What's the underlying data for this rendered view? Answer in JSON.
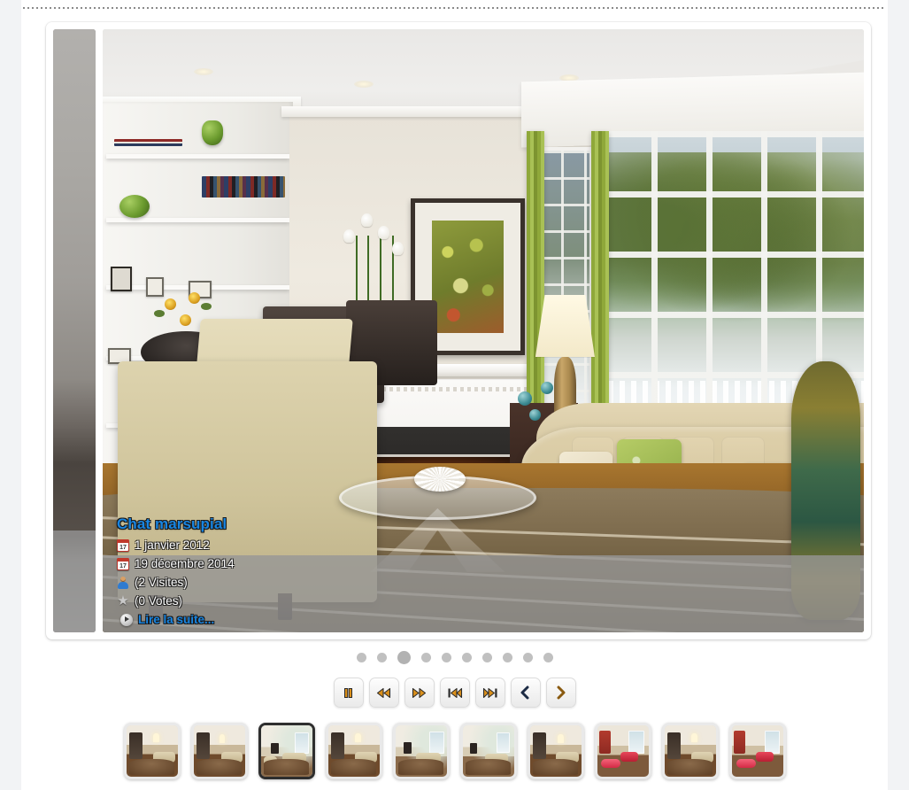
{
  "slideshow": {
    "caption": {
      "title": "Chat marsupial",
      "date_created": "1 janvier 2012",
      "date_modified": "19 décembre 2014",
      "visits": "(2 Visites)",
      "votes": "(0 Votes)",
      "read_more": "Lire la suite...",
      "icons": {
        "created": "calendar-icon",
        "modified": "calendar-icon",
        "visits": "user-icon",
        "votes": "star-icon",
        "read_more": "play-circle-icon"
      },
      "title_color": "#1884e0",
      "scrim_color": "#969696"
    },
    "pagination": {
      "count": 10,
      "active_index": 2
    },
    "controls": [
      {
        "name": "pause-button",
        "icon": "pause-icon",
        "label": "Pause"
      },
      {
        "name": "rewind-button",
        "icon": "rewind-icon",
        "label": "Rewind"
      },
      {
        "name": "fast-forward-button",
        "icon": "fast-forward-icon",
        "label": "Fast forward"
      },
      {
        "name": "first-button",
        "icon": "skip-start-icon",
        "label": "First"
      },
      {
        "name": "last-button",
        "icon": "skip-end-icon",
        "label": "Last"
      },
      {
        "name": "previous-button",
        "icon": "chevron-left-icon",
        "label": "Previous"
      },
      {
        "name": "next-button",
        "icon": "chevron-right-icon",
        "label": "Next"
      }
    ],
    "thumbnails": [
      {
        "index": 1,
        "scene": "modern-living-room-dark-tv",
        "selected": false
      },
      {
        "index": 2,
        "scene": "modern-living-room-dark-tv",
        "selected": false
      },
      {
        "index": 3,
        "scene": "fireplace-living-room-green",
        "selected": true
      },
      {
        "index": 4,
        "scene": "modern-living-room-dark-tv",
        "selected": false
      },
      {
        "index": 5,
        "scene": "fireplace-living-room-green",
        "selected": false
      },
      {
        "index": 6,
        "scene": "fireplace-living-room-green",
        "selected": false
      },
      {
        "index": 7,
        "scene": "modern-living-room-dark-tv",
        "selected": false
      },
      {
        "index": 8,
        "scene": "red-wall-lounge-pink-chair",
        "selected": false
      },
      {
        "index": 9,
        "scene": "modern-living-room-dark-tv",
        "selected": false
      },
      {
        "index": 10,
        "scene": "red-wall-lounge-pink-chair",
        "selected": false
      }
    ],
    "main_image": {
      "alt": "Salon avec cheminée, rideaux verts et grandes fenêtres",
      "accent_colors": {
        "curtains": "#8fa83a",
        "sofa": "#ded0ab",
        "rug": "#7d6b4d",
        "fire": "#ffb62e"
      }
    },
    "previous_slide_sliver": {
      "alt": "Diapositive précédente"
    }
  }
}
